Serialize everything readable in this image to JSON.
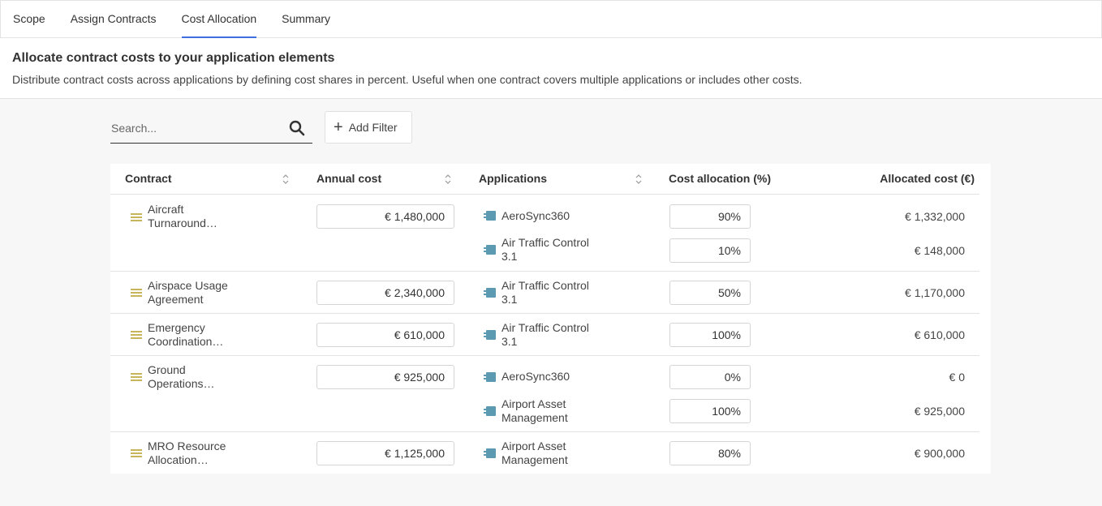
{
  "tabs": [
    {
      "label": "Scope"
    },
    {
      "label": "Assign Contracts"
    },
    {
      "label": "Cost Allocation"
    },
    {
      "label": "Summary"
    }
  ],
  "header": {
    "title": "Allocate contract costs to your application elements",
    "description": "Distribute contract costs across applications by defining cost shares in percent. Useful when one contract covers multiple applications or includes other costs."
  },
  "toolbar": {
    "search_placeholder": "Search...",
    "add_filter_label": "Add Filter"
  },
  "colors": {
    "tab_active": "#3d6fe0",
    "contract_icon": "#c8b45a",
    "app_icon": "#5b9ab0"
  },
  "table": {
    "columns": [
      "Contract",
      "Annual cost",
      "Applications",
      "Cost allocation (%)",
      "Allocated cost (€)"
    ],
    "rows": [
      {
        "contract": "Aircraft Turnaround…",
        "annual_cost": "€ 1,480,000",
        "apps": [
          {
            "name": "AeroSync360",
            "pct": "90%",
            "allocated": "€ 1,332,000"
          },
          {
            "name": "Air Traffic Control 3.1",
            "pct": "10%",
            "allocated": "€ 148,000"
          }
        ]
      },
      {
        "contract": "Airspace Usage Agreement",
        "annual_cost": "€ 2,340,000",
        "apps": [
          {
            "name": "Air Traffic Control 3.1",
            "pct": "50%",
            "allocated": "€ 1,170,000"
          }
        ]
      },
      {
        "contract": "Emergency Coordination…",
        "annual_cost": "€ 610,000",
        "apps": [
          {
            "name": "Air Traffic Control 3.1",
            "pct": "100%",
            "allocated": "€ 610,000"
          }
        ]
      },
      {
        "contract": "Ground Operations…",
        "annual_cost": "€ 925,000",
        "apps": [
          {
            "name": "AeroSync360",
            "pct": "0%",
            "allocated": "€ 0"
          },
          {
            "name": "Airport Asset Management",
            "pct": "100%",
            "allocated": "€ 925,000"
          }
        ]
      },
      {
        "contract": "MRO Resource Allocation…",
        "annual_cost": "€ 1,125,000",
        "apps": [
          {
            "name": "Airport Asset Management",
            "pct": "80%",
            "allocated": "€ 900,000"
          }
        ]
      }
    ]
  }
}
